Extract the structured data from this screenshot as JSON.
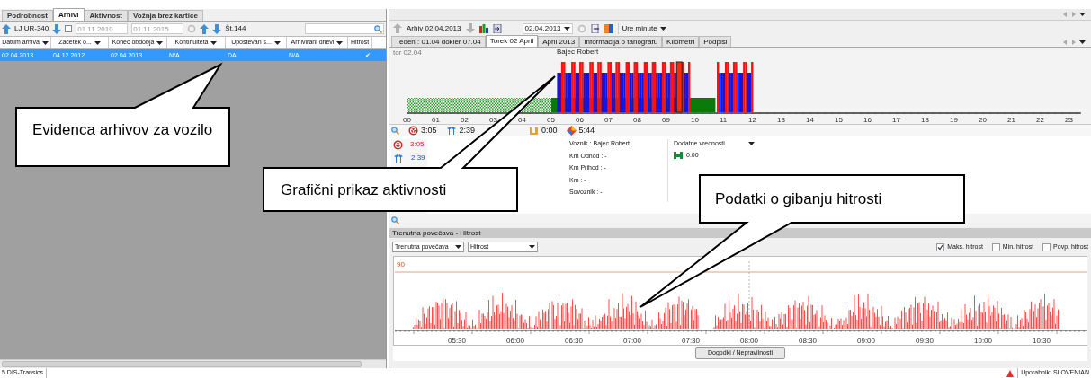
{
  "left_panel": {
    "tabs": [
      {
        "label": "Podrobnost",
        "selected": false
      },
      {
        "label": "Arhivi",
        "selected": true
      },
      {
        "label": "Aktivnost",
        "selected": false
      },
      {
        "label": "Vožnja brez kartice",
        "selected": false
      }
    ],
    "toolbar": {
      "vehicle": "LJ UR-340",
      "date_filter_checked": false,
      "date_from": "01.11.2010",
      "date_to": "01.11.2015",
      "count": "Št.144"
    },
    "columns": [
      "Datum arhiva",
      "Začetek o...",
      "Konec obdobja",
      "Kontinuiteta",
      "Upoštevan s...",
      "Arhivirani dnevi",
      "Hitrost"
    ],
    "rows": [
      {
        "selected": true,
        "cells": [
          "02.04.2013",
          "04.12.2012",
          "02.04.2013",
          "N/A",
          "DA",
          "N/A",
          "✔"
        ]
      }
    ]
  },
  "right_panel": {
    "toolbar": {
      "archive": "Arhiv 02.04.2013",
      "date": "02.04.2013",
      "unit": "Ure minute"
    },
    "tabs": [
      {
        "label": "Teden : 01.04 dokler 07.04",
        "selected": false
      },
      {
        "label": "Torek 02 April",
        "selected": true
      },
      {
        "label": "April 2013",
        "selected": false
      },
      {
        "label": "Informacija o tahografu",
        "selected": false
      },
      {
        "label": "Kilometri",
        "selected": false
      },
      {
        "label": "Podpisi",
        "selected": false
      }
    ],
    "timeline": {
      "corner_label": "tor 02.04",
      "driver": "Bajec Robert",
      "hour_ticks": [
        "00",
        "01",
        "02",
        "03",
        "04",
        "05",
        "06",
        "07",
        "08",
        "09",
        "10",
        "11",
        "12",
        "13",
        "14",
        "15",
        "16",
        "17",
        "18",
        "19",
        "20",
        "21",
        "22",
        "23"
      ]
    },
    "summary": [
      {
        "kind": "driving",
        "value": "3:05"
      },
      {
        "kind": "work",
        "value": "2:39"
      },
      {
        "kind": "availability",
        "value": "0:00"
      },
      {
        "kind": "total",
        "value": "5:44"
      }
    ],
    "detail_totals": [
      {
        "kind": "driving",
        "value": "3:05"
      },
      {
        "kind": "work",
        "value": "2:39"
      }
    ],
    "driver_info": [
      "Voznik : Bajec Robert",
      "Km Odhod : -",
      "Km Prihod : -",
      "Km : -",
      "Sovoznik : -"
    ],
    "extra": {
      "title": "Dodatne vrednosti",
      "value": "0:00"
    },
    "speed": {
      "title": "Trenutna povečava - Hitrost",
      "zoom_select": "Trenutna povečava",
      "measure_select": "Hitrost",
      "options": [
        {
          "label": "Maks. hitrost",
          "checked": true
        },
        {
          "label": "Min. hitrost",
          "checked": false
        },
        {
          "label": "Povp. hitrost",
          "checked": false
        }
      ],
      "y_label": "90",
      "time_ticks": [
        "05:30",
        "06:00",
        "06:30",
        "07:00",
        "07:30",
        "08:00",
        "08:30",
        "09:00",
        "09:30",
        "10:00",
        "10:30"
      ]
    },
    "events_button": "Dogodki / Nepravilnosti"
  },
  "status_bar": {
    "left": "5 DIS-Transics",
    "user": "Uporabnik: SLOVENIAN"
  },
  "callouts": [
    {
      "text": "Evidenca arhivov za vozilo"
    },
    {
      "text": "Grafični prikaz aktivnosti"
    },
    {
      "text": "Podatki o gibanju hitrosti"
    }
  ]
}
